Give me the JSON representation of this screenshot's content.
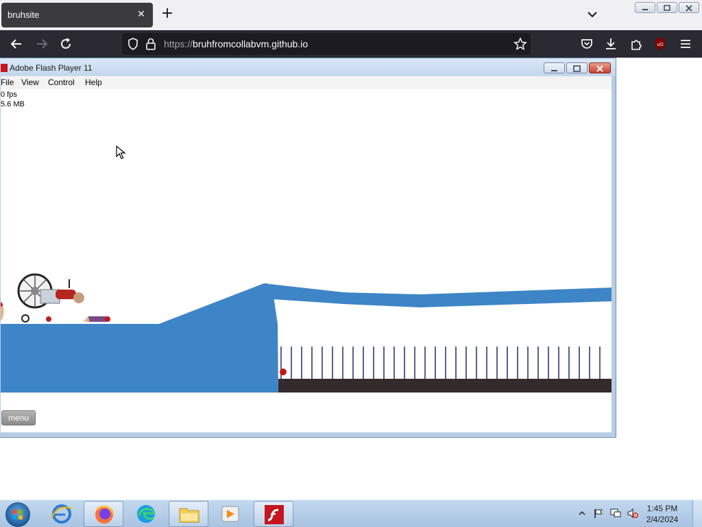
{
  "browser": {
    "tab": {
      "title": "bruhsite"
    },
    "url": {
      "scheme": "https://",
      "host": "bruhfromcollabvm.github.io"
    }
  },
  "flash_window": {
    "title": "Adobe Flash Player 11",
    "menu": [
      "File",
      "View",
      "Control",
      "Help"
    ],
    "stats": {
      "fps": "0 fps",
      "memory": "5.6 MB"
    },
    "game": {
      "menu_button": "menu"
    }
  },
  "taskbar": {
    "apps": [
      "internet-explorer",
      "firefox",
      "edge",
      "file-explorer",
      "media-player",
      "flash-player"
    ],
    "clock": {
      "time": "1:45 PM",
      "date": "2/4/2024"
    }
  },
  "colors": {
    "accent_blue": "#3d85c6",
    "spike_floor": "#332b2b",
    "firefox_dark": "#2b2a33"
  }
}
